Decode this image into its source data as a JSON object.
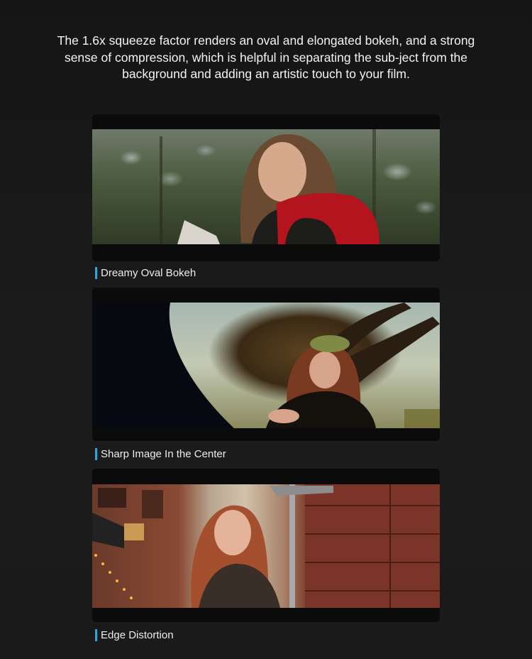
{
  "intro_text": "The 1.6x squeeze factor renders an oval and elongated bokeh, and a strong sense of compression, which is helpful in separating the sub-ject from the background and adding an artistic touch to your film.",
  "sections": [
    {
      "caption": "Dreamy Oval Bokeh"
    },
    {
      "caption": "Sharp Image In the Center"
    },
    {
      "caption": "Edge Distortion"
    }
  ],
  "colors": {
    "accent": "#2aa7e0",
    "background": "#1a1a1a",
    "letterbox": "#0b0b0b"
  }
}
